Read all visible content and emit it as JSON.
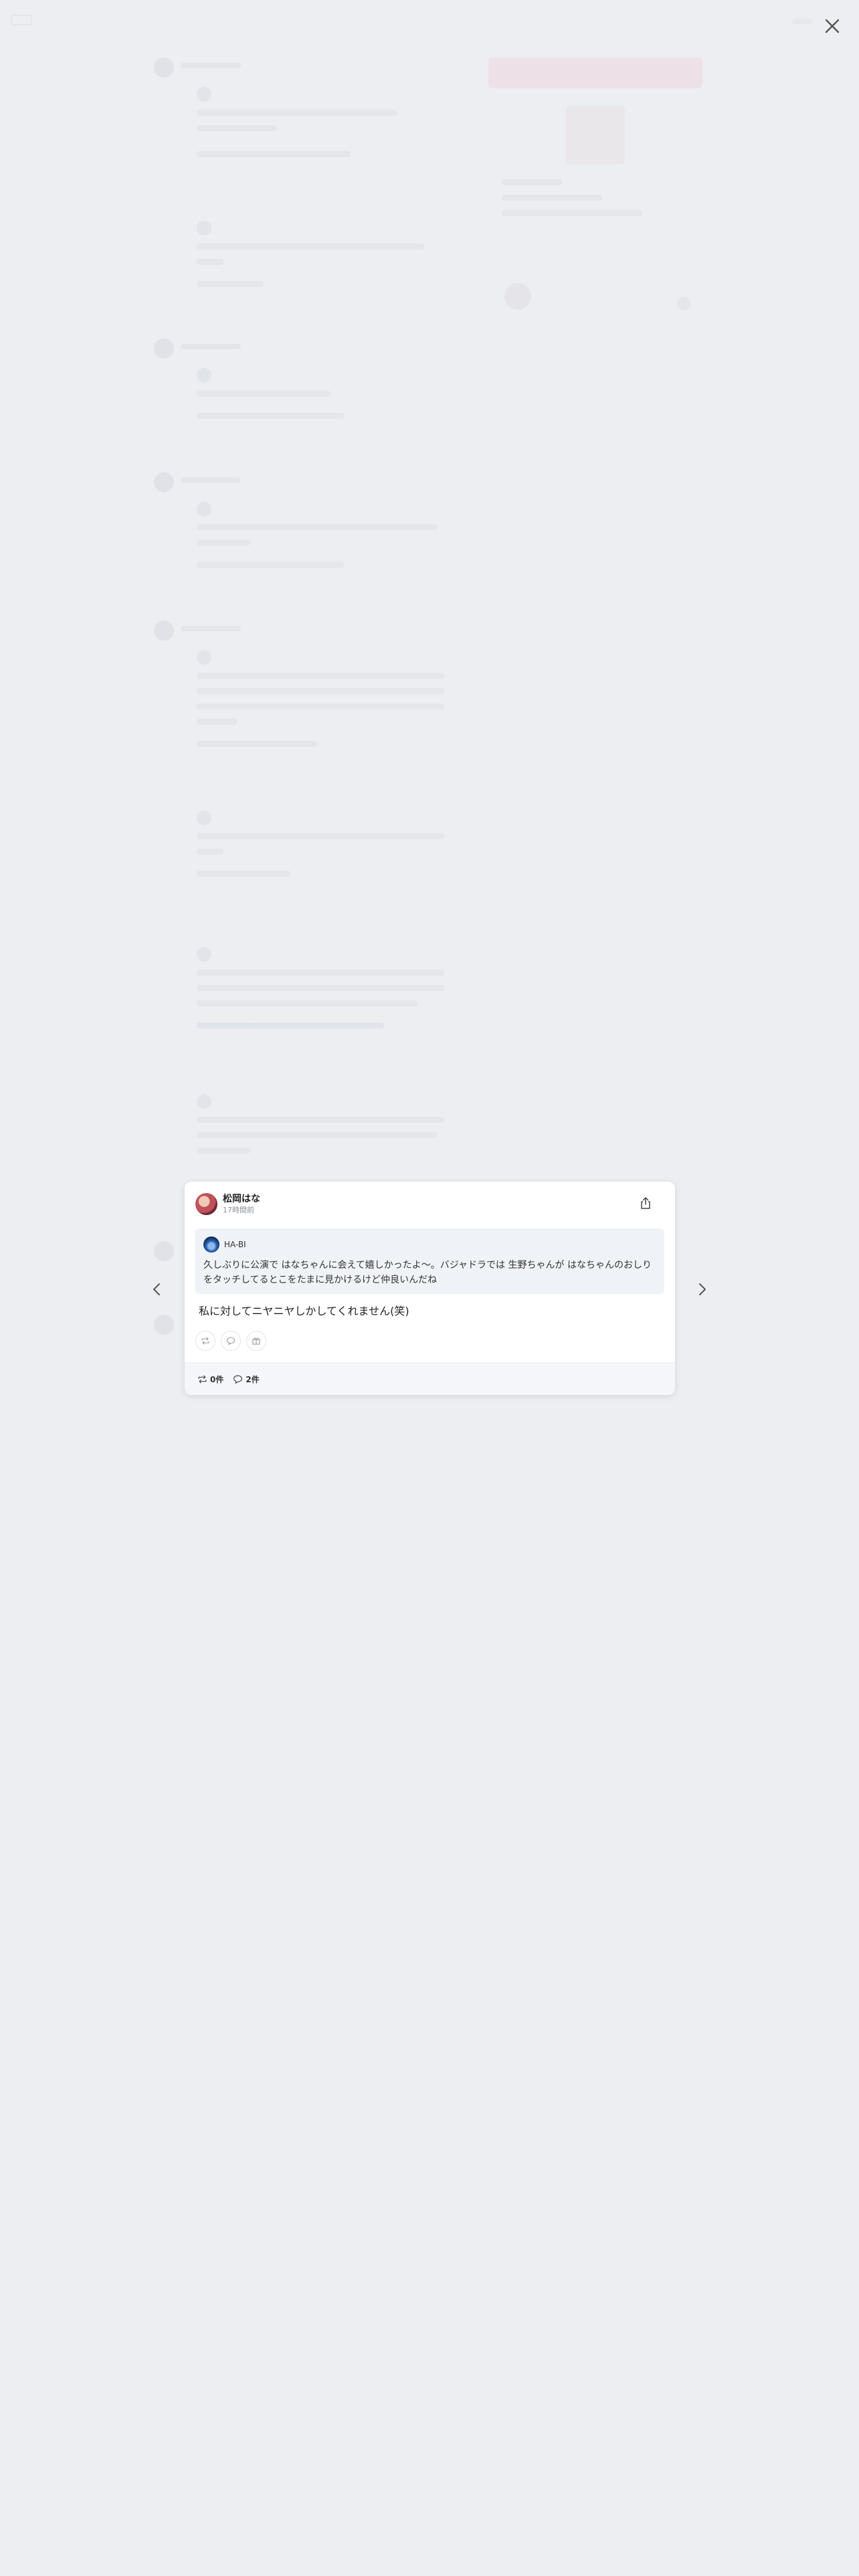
{
  "post": {
    "author": "松岡はな",
    "time": "17時間前",
    "quoted": {
      "author": "HA-BI",
      "text": "久しぶりに公演で はなちゃんに会えて嬉しかったよ〜。バジャドラでは 生野ちゃんが はなちゃんのおしりをタッチしてるとこをたまに見かけるけど仲良いんだね"
    },
    "text": "私に対してニヤニヤしかしてくれません(笑)",
    "counts": {
      "repost": "0件",
      "comment": "2件"
    }
  },
  "icons": {
    "close": "close-icon",
    "prev": "chevron-left-icon",
    "next": "chevron-right-icon",
    "share": "share-icon",
    "repost": "repost-icon",
    "comment": "comment-icon",
    "gift": "gift-icon"
  },
  "colors": {
    "overlay_background": "#eceef1",
    "quote_background": "#eff2f6",
    "footer_background": "#f4f6f9",
    "accent_pink": "#f3b7c6"
  }
}
